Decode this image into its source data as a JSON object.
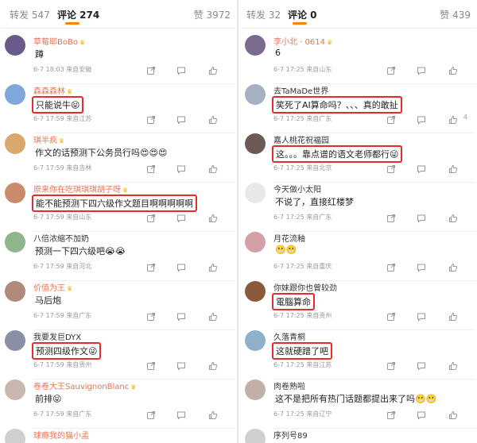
{
  "left": {
    "tabs": {
      "repost": "转发 547",
      "comments": "评论 274",
      "likes": "赞 3972"
    },
    "comments": [
      {
        "user": "草莓耶BoBo",
        "name_color": "#eb7350",
        "vip": true,
        "text": "蹲",
        "time": "6-7 18:03",
        "location": "来自安徽",
        "likes": "",
        "highlight": false,
        "avatar_color": "#6b5b8a"
      },
      {
        "user": "森森森林",
        "name_color": "#eb7350",
        "vip": true,
        "text": "只能说牛😝",
        "time": "6-7 17:59",
        "location": "来自江苏",
        "likes": "",
        "highlight": true,
        "avatar_color": "#7fa7d9"
      },
      {
        "user": "琪半疯",
        "name_color": "#eb7350",
        "vip": true,
        "text": "作文的话预测下公务员行吗😍😍😍",
        "time": "6-7 17:59",
        "location": "来自吉林",
        "likes": "",
        "highlight": false,
        "avatar_color": "#d9a86b"
      },
      {
        "user": "原来你在吃琪琪琪胡子呀",
        "name_color": "#eb7350",
        "vip": true,
        "text": "能不能预测下四六级作文题目啊啊啊啊啊",
        "time": "6-7 17:59",
        "location": "来自山东",
        "likes": "",
        "highlight": true,
        "avatar_color": "#c98b6b"
      },
      {
        "user": "八倍浓缩不加奶",
        "name_color": "#333333",
        "vip": false,
        "text": "预测一下四六级吧😭😭",
        "time": "6-7 17:59",
        "location": "来自河北",
        "likes": "",
        "highlight": false,
        "avatar_color": "#8fb58a"
      },
      {
        "user": "价值为王",
        "name_color": "#eb7350",
        "vip": true,
        "text": "马后炮",
        "time": "6-7 17:59",
        "location": "来自广东",
        "likes": "",
        "highlight": false,
        "avatar_color": "#b08a7a"
      },
      {
        "user": "我要发巨DYX",
        "name_color": "#333333",
        "vip": false,
        "text": "预测四级作文😜",
        "time": "6-7 17:59",
        "location": "来自贵州",
        "likes": "",
        "highlight": true,
        "avatar_color": "#8a8fa5"
      },
      {
        "user": "卷卷大王SauvignonBlanc",
        "name_color": "#eb7350",
        "vip": true,
        "text": "前排😝",
        "time": "6-7 17:59",
        "location": "来自广东",
        "likes": "",
        "highlight": false,
        "avatar_color": "#c9b8b0"
      }
    ],
    "cut_user": "球瘾我的猫小孟"
  },
  "right": {
    "tabs": {
      "repost": "转发 32",
      "comments": "评论 0",
      "likes": "赞 439"
    },
    "comments": [
      {
        "user": "李小北 · 0614",
        "name_color": "#eb7350",
        "vip": true,
        "text": "6",
        "time": "6-7 17:25",
        "location": "来自山东",
        "likes": "",
        "highlight": false,
        "avatar_color": "#7a6b8f"
      },
      {
        "user": "去TaMaDe世界",
        "name_color": "#333333",
        "vip": false,
        "text": "笑死了AI算命吗？、、、真的敢扯",
        "time": "6-7 17:25",
        "location": "来自广东",
        "likes": "4",
        "highlight": true,
        "avatar_color": "#a5b0c0"
      },
      {
        "user": "嘉人桃花祝福园",
        "name_color": "#333333",
        "vip": false,
        "text": "这。。。靠点谱的语文老师都行😜",
        "time": "6-7 17:25",
        "location": "来自北京",
        "likes": "",
        "highlight": true,
        "avatar_color": "#6b5a55"
      },
      {
        "user": "今天做小太阳",
        "name_color": "#333333",
        "vip": false,
        "text": "不说了，直接红楼梦",
        "time": "6-7 17:25",
        "location": "来自广东",
        "likes": "",
        "highlight": false,
        "avatar_color": "#e8e8e8"
      },
      {
        "user": "月花流釉",
        "name_color": "#333333",
        "vip": false,
        "text": "😬😬",
        "time": "6-7 17:25",
        "location": "来自重庆",
        "likes": "",
        "highlight": false,
        "avatar_color": "#d4a0a8"
      },
      {
        "user": "你妹跟你也曾较劲",
        "name_color": "#333333",
        "vip": false,
        "text": "電腦算命",
        "time": "6-7 17:25",
        "location": "来自贵州",
        "likes": "",
        "highlight": true,
        "avatar_color": "#8a5a3a"
      },
      {
        "user": "久落青桐",
        "name_color": "#333333",
        "vip": false,
        "text": "这就硬蹭了吧",
        "time": "6-7 17:25",
        "location": "来自江苏",
        "likes": "",
        "highlight": true,
        "avatar_color": "#8fb0c9"
      },
      {
        "user": "肉卷熟啦",
        "name_color": "#333333",
        "vip": false,
        "text": "这不是把所有热门话题都提出来了吗😬😬",
        "time": "6-7 17:25",
        "location": "来自辽宁",
        "likes": "",
        "highlight": false,
        "avatar_color": "#c0b0a8"
      }
    ],
    "cut_user": "序列号89"
  },
  "colors": {
    "accent": "#ff8200",
    "highlight_box": "#e52b2b",
    "username_vip": "#eb7350",
    "meta_gray": "#9a9a9a"
  },
  "icons": [
    "share-icon",
    "comment-icon",
    "like-icon",
    "vip-crown-icon"
  ]
}
